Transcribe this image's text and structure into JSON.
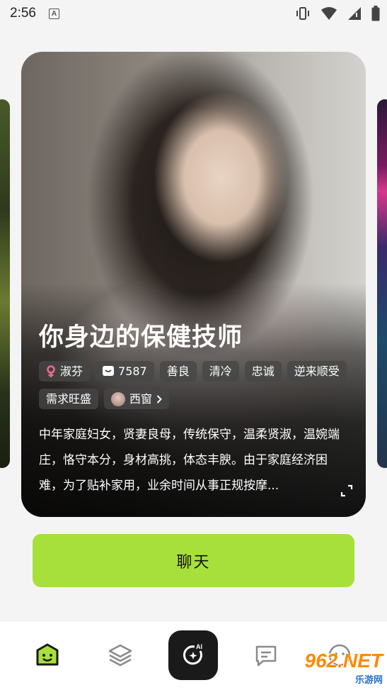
{
  "status_bar": {
    "time": "2:56",
    "notif_letter": "A"
  },
  "card": {
    "title": "你身边的保健技师",
    "gender_tag": "淑芬",
    "chat_count": "7587",
    "traits": [
      "善良",
      "清冷",
      "忠诚",
      "逆来顺受",
      "需求旺盛"
    ],
    "creator_tag": "西窗",
    "description": "中年家庭妇女，贤妻良母，传统保守，温柔贤淑，温婉端庄，恪守本分，身材高挑，体态丰腴。由于家庭经济困难，为了贴补家用，业余时间从事正规按摩..."
  },
  "actions": {
    "chat_label": "聊天"
  },
  "bottom_nav": {
    "items": [
      {
        "icon": "home-face-icon",
        "active": true
      },
      {
        "icon": "layers-icon",
        "active": false
      },
      {
        "icon": "ai-create-icon",
        "active": false
      },
      {
        "icon": "message-icon",
        "active": false
      },
      {
        "icon": "profile-face-icon",
        "active": false
      }
    ],
    "ai_label": "AI"
  },
  "colors": {
    "accent": "#a7e03a",
    "active_nav": "#a7e03a",
    "nav_dark": "#1a1a1a"
  },
  "watermark": {
    "main": "962.NET",
    "sub": "乐游网"
  }
}
